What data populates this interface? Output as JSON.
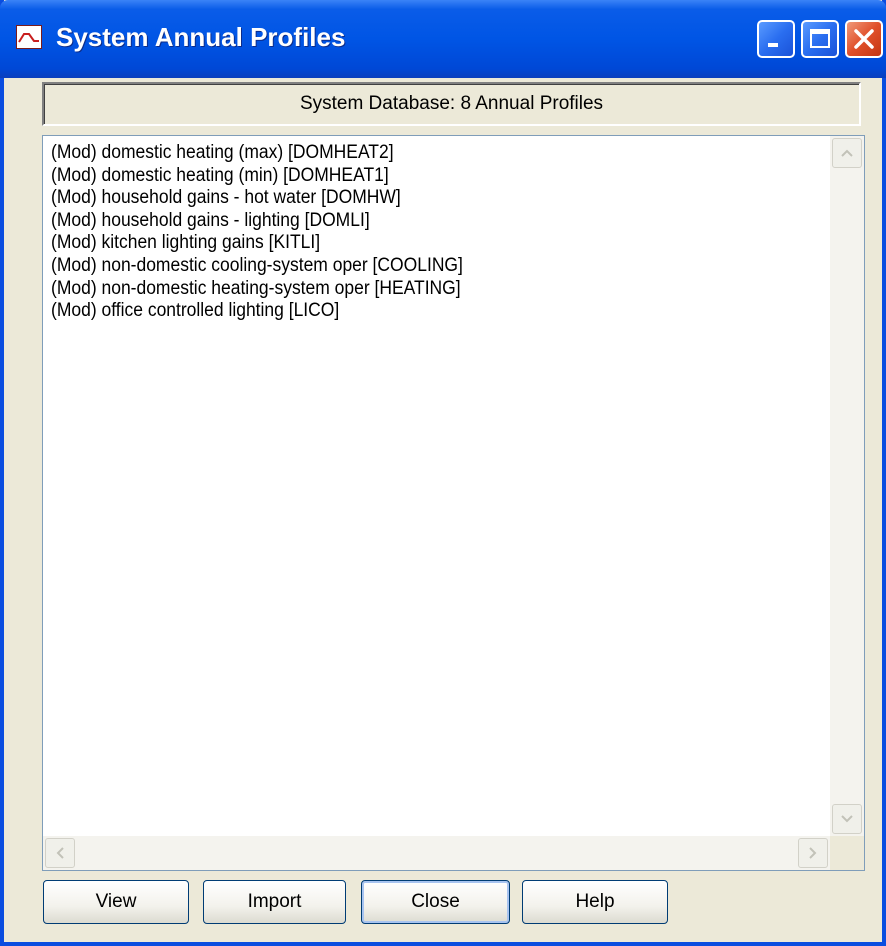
{
  "window": {
    "title": "System Annual Profiles",
    "icon": "annual-profile-chart-icon",
    "controls": [
      "minimize-icon",
      "maximize-icon",
      "close-icon"
    ]
  },
  "header": {
    "text": "System Database: 8 Annual Profiles"
  },
  "profiles": {
    "items": [
      "(Mod) domestic heating (max) [DOMHEAT2]",
      "(Mod) domestic heating (min) [DOMHEAT1]",
      "(Mod) household gains - hot water [DOMHW]",
      "(Mod) household gains - lighting [DOMLI]",
      "(Mod) kitchen lighting gains [KITLI]",
      "(Mod) non-domestic cooling-system oper [COOLING]",
      "(Mod) non-domestic heating-system oper [HEATING]",
      "(Mod) office controlled lighting [LICO]"
    ]
  },
  "buttons": {
    "view": "View",
    "import": "Import",
    "close": "Close",
    "help": "Help"
  },
  "colors": {
    "titlebar": "#0055e5",
    "face": "#ece9d8",
    "close_button": "#e0502a"
  }
}
